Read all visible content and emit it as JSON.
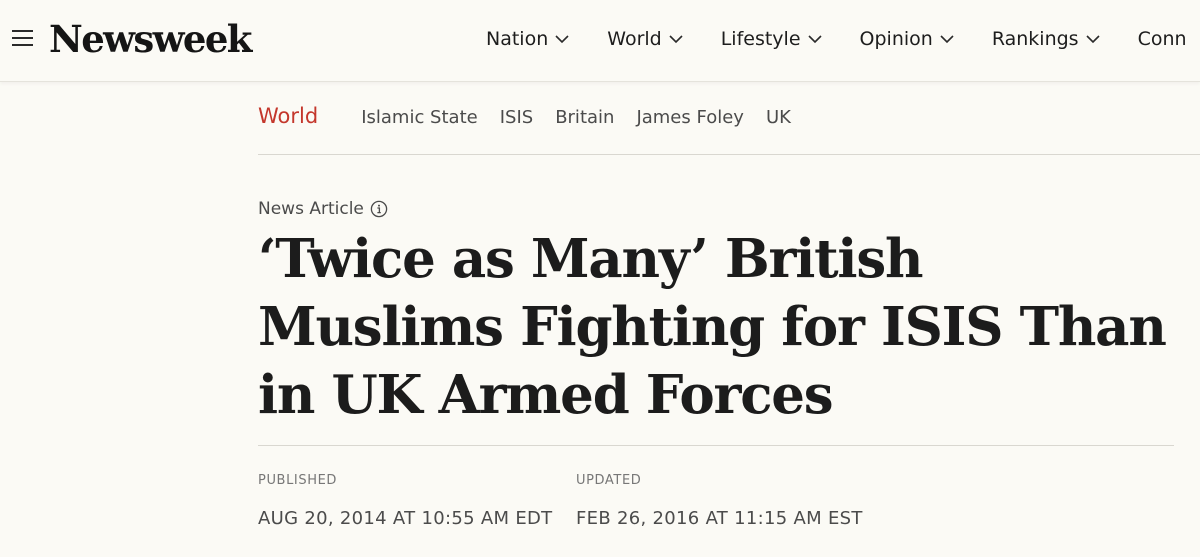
{
  "header": {
    "logo": "Newsweek",
    "nav": [
      {
        "label": "Nation",
        "icon": "chevron-down-icon"
      },
      {
        "label": "World",
        "icon": "chevron-down-icon"
      },
      {
        "label": "Lifestyle",
        "icon": "chevron-down-icon"
      },
      {
        "label": "Opinion",
        "icon": "chevron-down-icon"
      },
      {
        "label": "Rankings",
        "icon": "chevron-down-icon"
      },
      {
        "label": "Conn"
      }
    ]
  },
  "tags": {
    "section": "World",
    "items": [
      "Islamic State",
      "ISIS",
      "Britain",
      "James Foley",
      "UK"
    ]
  },
  "article": {
    "type_label": "News Article",
    "headline": "‘Twice as Many’ British Muslims Fighting for ISIS Than in UK Armed Forces",
    "published_label": "PUBLISHED",
    "published_value": "AUG 20, 2014 AT 10:55 AM EDT",
    "updated_label": "UPDATED",
    "updated_value": "FEB 26, 2016 AT 11:15 AM EST"
  },
  "colors": {
    "background": "#fbfaf5",
    "accent": "#c4372c",
    "text": "#1d1d1d"
  }
}
